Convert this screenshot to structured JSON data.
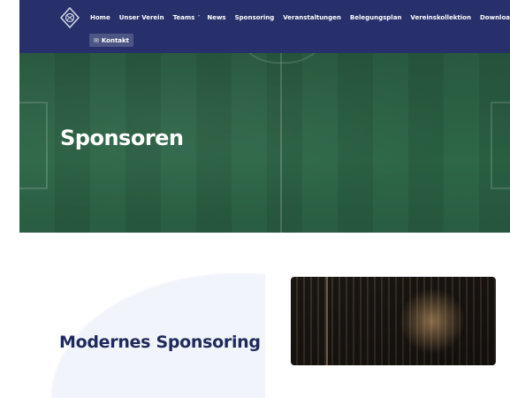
{
  "nav": {
    "items": [
      {
        "label": "Home"
      },
      {
        "label": "Unser Verein"
      },
      {
        "label": "Teams"
      },
      {
        "label": "News"
      },
      {
        "label": "Sponsoring"
      },
      {
        "label": "Veranstaltungen"
      },
      {
        "label": "Belegungsplan"
      },
      {
        "label": "Vereinskollektion"
      },
      {
        "label": "Download"
      }
    ],
    "kontakt": {
      "label": "Kontakt",
      "icon": "mail-icon"
    },
    "logo_icon": "club-crest-icon",
    "teams_icon": "chevron-down-icon"
  },
  "hero": {
    "title": "Sponsoren"
  },
  "section": {
    "title": "Modernes Sponsoring"
  },
  "colors": {
    "nav_bg": "#27306a",
    "title_color": "#1f2a5c",
    "hero_green": "#2d6547"
  }
}
